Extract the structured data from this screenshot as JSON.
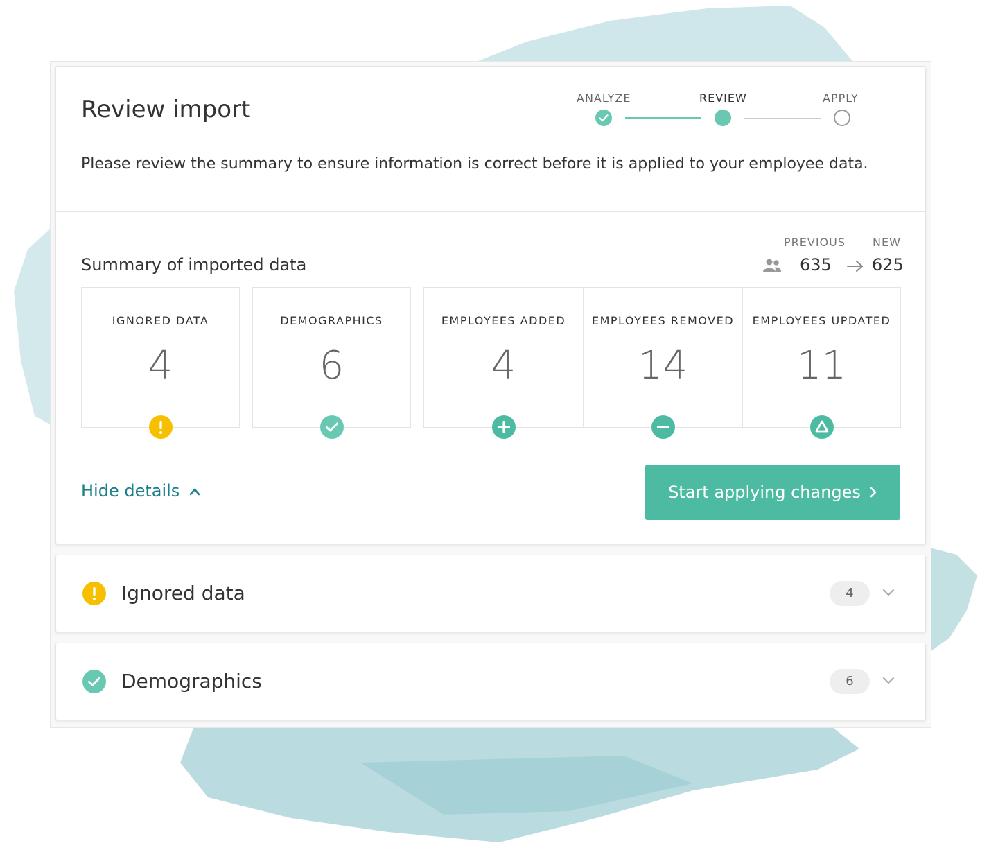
{
  "header": {
    "title": "Review import",
    "description": "Please review the summary to ensure information is correct before it is applied to your employee data."
  },
  "stepper": {
    "steps": [
      {
        "label": "ANALYZE",
        "state": "done"
      },
      {
        "label": "REVIEW",
        "state": "active"
      },
      {
        "label": "APPLY",
        "state": "todo"
      }
    ]
  },
  "summary": {
    "title": "Summary of imported data",
    "previous_label": "PREVIOUS",
    "new_label": "NEW",
    "previous_value": "635",
    "new_value": "625",
    "tiles": [
      {
        "label": "IGNORED DATA",
        "value": "4",
        "icon": "warning-icon"
      },
      {
        "label": "DEMOGRAPHICS",
        "value": "6",
        "icon": "check-circle-icon"
      },
      {
        "label": "EMPLOYEES ADDED",
        "value": "4",
        "icon": "plus-circle-icon"
      },
      {
        "label": "EMPLOYEES REMOVED",
        "value": "14",
        "icon": "minus-circle-icon"
      },
      {
        "label": "EMPLOYEES UPDATED",
        "value": "11",
        "icon": "triangle-circle-icon"
      }
    ]
  },
  "actions": {
    "hide_details": "Hide details",
    "apply_button": "Start applying changes"
  },
  "accordions": [
    {
      "title": "Ignored data",
      "count": "4",
      "icon": "warning-icon"
    },
    {
      "title": "Demographics",
      "count": "6",
      "icon": "check-circle-icon"
    }
  ],
  "colors": {
    "accent": "#4dbba2",
    "teal_light": "#69c8b2",
    "warning": "#f6c000",
    "link": "#1a7f8a"
  }
}
